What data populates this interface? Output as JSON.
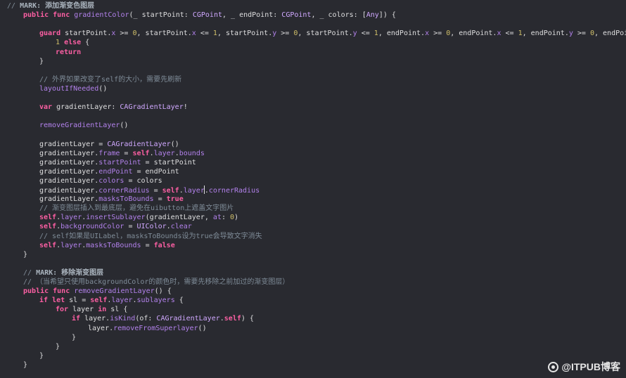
{
  "editor": {
    "lines": [
      {
        "indent": 0,
        "tokens": [
          {
            "t": "// ",
            "c": "c-comment"
          },
          {
            "t": "MARK: 添加渐变色图层",
            "c": "c-mark"
          }
        ]
      },
      {
        "indent": 1,
        "tokens": [
          {
            "t": "public func ",
            "c": "c-kw"
          },
          {
            "t": "gradientColor",
            "c": "c-call"
          },
          {
            "t": "(_ startPoint: ",
            "c": "c-plain"
          },
          {
            "t": "CGPoint",
            "c": "c-type"
          },
          {
            "t": ", _ endPoint: ",
            "c": "c-plain"
          },
          {
            "t": "CGPoint",
            "c": "c-type"
          },
          {
            "t": ", _ colors: [",
            "c": "c-plain"
          },
          {
            "t": "Any",
            "c": "c-type"
          },
          {
            "t": "]) {",
            "c": "c-plain"
          }
        ]
      },
      {
        "indent": 0,
        "tokens": []
      },
      {
        "indent": 2,
        "tokens": [
          {
            "t": "guard ",
            "c": "c-kw"
          },
          {
            "t": "startPoint.",
            "c": "c-plain"
          },
          {
            "t": "x",
            "c": "c-call"
          },
          {
            "t": " >= ",
            "c": "c-plain"
          },
          {
            "t": "0",
            "c": "c-num"
          },
          {
            "t": ", startPoint.",
            "c": "c-plain"
          },
          {
            "t": "x",
            "c": "c-call"
          },
          {
            "t": " <= ",
            "c": "c-plain"
          },
          {
            "t": "1",
            "c": "c-num"
          },
          {
            "t": ", startPoint.",
            "c": "c-plain"
          },
          {
            "t": "y",
            "c": "c-call"
          },
          {
            "t": " >= ",
            "c": "c-plain"
          },
          {
            "t": "0",
            "c": "c-num"
          },
          {
            "t": ", startPoint.",
            "c": "c-plain"
          },
          {
            "t": "y",
            "c": "c-call"
          },
          {
            "t": " <= ",
            "c": "c-plain"
          },
          {
            "t": "1",
            "c": "c-num"
          },
          {
            "t": ", endPoint.",
            "c": "c-plain"
          },
          {
            "t": "x",
            "c": "c-call"
          },
          {
            "t": " >= ",
            "c": "c-plain"
          },
          {
            "t": "0",
            "c": "c-num"
          },
          {
            "t": ", endPoint.",
            "c": "c-plain"
          },
          {
            "t": "x",
            "c": "c-call"
          },
          {
            "t": " <= ",
            "c": "c-plain"
          },
          {
            "t": "1",
            "c": "c-num"
          },
          {
            "t": ", endPoint.",
            "c": "c-plain"
          },
          {
            "t": "y",
            "c": "c-call"
          },
          {
            "t": " >= ",
            "c": "c-plain"
          },
          {
            "t": "0",
            "c": "c-num"
          },
          {
            "t": ", endPoint.",
            "c": "c-plain"
          },
          {
            "t": "y",
            "c": "c-call"
          },
          {
            "t": " <=",
            "c": "c-plain"
          }
        ]
      },
      {
        "indent": 3,
        "tokens": [
          {
            "t": "1",
            "c": "c-num"
          },
          {
            "t": " ",
            "c": "c-plain"
          },
          {
            "t": "else",
            "c": "c-kw"
          },
          {
            "t": " {",
            "c": "c-plain"
          }
        ]
      },
      {
        "indent": 3,
        "tokens": [
          {
            "t": "return",
            "c": "c-kw"
          }
        ]
      },
      {
        "indent": 2,
        "tokens": [
          {
            "t": "}",
            "c": "c-plain"
          }
        ]
      },
      {
        "indent": 0,
        "tokens": []
      },
      {
        "indent": 2,
        "tokens": [
          {
            "t": "// 外界如果改变了self的大小，需要先刷新",
            "c": "c-comment"
          }
        ]
      },
      {
        "indent": 2,
        "tokens": [
          {
            "t": "layoutIfNeeded",
            "c": "c-call"
          },
          {
            "t": "()",
            "c": "c-plain"
          }
        ]
      },
      {
        "indent": 0,
        "tokens": []
      },
      {
        "indent": 2,
        "tokens": [
          {
            "t": "var ",
            "c": "c-kw"
          },
          {
            "t": "gradientLayer: ",
            "c": "c-plain"
          },
          {
            "t": "CAGradientLayer",
            "c": "c-type"
          },
          {
            "t": "!",
            "c": "c-plain"
          }
        ]
      },
      {
        "indent": 0,
        "tokens": []
      },
      {
        "indent": 2,
        "tokens": [
          {
            "t": "removeGradientLayer",
            "c": "c-call"
          },
          {
            "t": "()",
            "c": "c-plain"
          }
        ]
      },
      {
        "indent": 0,
        "tokens": []
      },
      {
        "indent": 2,
        "tokens": [
          {
            "t": "gradientLayer = ",
            "c": "c-plain"
          },
          {
            "t": "CAGradientLayer",
            "c": "c-type"
          },
          {
            "t": "()",
            "c": "c-plain"
          }
        ]
      },
      {
        "indent": 2,
        "tokens": [
          {
            "t": "gradientLayer.",
            "c": "c-plain"
          },
          {
            "t": "frame",
            "c": "c-call"
          },
          {
            "t": " = ",
            "c": "c-plain"
          },
          {
            "t": "self",
            "c": "c-kw"
          },
          {
            "t": ".",
            "c": "c-plain"
          },
          {
            "t": "layer",
            "c": "c-call"
          },
          {
            "t": ".",
            "c": "c-plain"
          },
          {
            "t": "bounds",
            "c": "c-call"
          }
        ]
      },
      {
        "indent": 2,
        "tokens": [
          {
            "t": "gradientLayer.",
            "c": "c-plain"
          },
          {
            "t": "startPoint",
            "c": "c-call"
          },
          {
            "t": " = startPoint",
            "c": "c-plain"
          }
        ]
      },
      {
        "indent": 2,
        "tokens": [
          {
            "t": "gradientLayer.",
            "c": "c-plain"
          },
          {
            "t": "endPoint",
            "c": "c-call"
          },
          {
            "t": " = endPoint",
            "c": "c-plain"
          }
        ]
      },
      {
        "indent": 2,
        "tokens": [
          {
            "t": "gradientLayer.",
            "c": "c-plain"
          },
          {
            "t": "colors",
            "c": "c-call"
          },
          {
            "t": " = colors",
            "c": "c-plain"
          }
        ]
      },
      {
        "indent": 2,
        "tokens": [
          {
            "t": "gradientLayer.",
            "c": "c-plain"
          },
          {
            "t": "cornerRadius",
            "c": "c-call"
          },
          {
            "t": " = ",
            "c": "c-plain"
          },
          {
            "t": "self",
            "c": "c-kw"
          },
          {
            "t": ".",
            "c": "c-plain"
          },
          {
            "t": "layer",
            "c": "c-call"
          },
          {
            "t": "|",
            "c": "caret"
          },
          {
            "t": ".",
            "c": "c-plain"
          },
          {
            "t": "cornerRadius",
            "c": "c-call"
          }
        ]
      },
      {
        "indent": 2,
        "tokens": [
          {
            "t": "gradientLayer.",
            "c": "c-plain"
          },
          {
            "t": "masksToBounds",
            "c": "c-call"
          },
          {
            "t": " = ",
            "c": "c-plain"
          },
          {
            "t": "true",
            "c": "c-kw"
          }
        ]
      },
      {
        "indent": 2,
        "tokens": [
          {
            "t": "// 渐变图层插入到最底层，避免在uibutton上遮盖文字图片",
            "c": "c-comment"
          }
        ]
      },
      {
        "indent": 2,
        "tokens": [
          {
            "t": "self",
            "c": "c-kw"
          },
          {
            "t": ".",
            "c": "c-plain"
          },
          {
            "t": "layer",
            "c": "c-call"
          },
          {
            "t": ".",
            "c": "c-plain"
          },
          {
            "t": "insertSublayer",
            "c": "c-call"
          },
          {
            "t": "(gradientLayer, ",
            "c": "c-plain"
          },
          {
            "t": "at",
            "c": "c-call"
          },
          {
            "t": ": ",
            "c": "c-plain"
          },
          {
            "t": "0",
            "c": "c-num"
          },
          {
            "t": ")",
            "c": "c-plain"
          }
        ]
      },
      {
        "indent": 2,
        "tokens": [
          {
            "t": "self",
            "c": "c-kw"
          },
          {
            "t": ".",
            "c": "c-plain"
          },
          {
            "t": "backgroundColor",
            "c": "c-call"
          },
          {
            "t": " = ",
            "c": "c-plain"
          },
          {
            "t": "UIColor",
            "c": "c-type"
          },
          {
            "t": ".",
            "c": "c-plain"
          },
          {
            "t": "clear",
            "c": "c-call"
          }
        ]
      },
      {
        "indent": 2,
        "tokens": [
          {
            "t": "// self如果是UILabel，masksToBounds设为true会导致文字消失",
            "c": "c-comment"
          }
        ]
      },
      {
        "indent": 2,
        "tokens": [
          {
            "t": "self",
            "c": "c-kw"
          },
          {
            "t": ".",
            "c": "c-plain"
          },
          {
            "t": "layer",
            "c": "c-call"
          },
          {
            "t": ".",
            "c": "c-plain"
          },
          {
            "t": "masksToBounds",
            "c": "c-call"
          },
          {
            "t": " = ",
            "c": "c-plain"
          },
          {
            "t": "false",
            "c": "c-kw"
          }
        ]
      },
      {
        "indent": 1,
        "tokens": [
          {
            "t": "}",
            "c": "c-plain"
          }
        ]
      },
      {
        "indent": 0,
        "tokens": []
      },
      {
        "indent": 1,
        "tokens": [
          {
            "t": "// ",
            "c": "c-comment"
          },
          {
            "t": "MARK: 移除渐变图层",
            "c": "c-mark"
          }
        ]
      },
      {
        "indent": 1,
        "tokens": [
          {
            "t": "// （当希望只使用backgroundColor的颜色时，需要先移除之前加过的渐变图层）",
            "c": "c-comment"
          }
        ]
      },
      {
        "indent": 1,
        "tokens": [
          {
            "t": "public func ",
            "c": "c-kw"
          },
          {
            "t": "removeGradientLayer",
            "c": "c-call"
          },
          {
            "t": "() {",
            "c": "c-plain"
          }
        ]
      },
      {
        "indent": 2,
        "tokens": [
          {
            "t": "if let ",
            "c": "c-kw"
          },
          {
            "t": "sl = ",
            "c": "c-plain"
          },
          {
            "t": "self",
            "c": "c-kw"
          },
          {
            "t": ".",
            "c": "c-plain"
          },
          {
            "t": "layer",
            "c": "c-call"
          },
          {
            "t": ".",
            "c": "c-plain"
          },
          {
            "t": "sublayers",
            "c": "c-call"
          },
          {
            "t": " {",
            "c": "c-plain"
          }
        ]
      },
      {
        "indent": 3,
        "tokens": [
          {
            "t": "for ",
            "c": "c-kw"
          },
          {
            "t": "layer ",
            "c": "c-plain"
          },
          {
            "t": "in ",
            "c": "c-kw"
          },
          {
            "t": "sl {",
            "c": "c-plain"
          }
        ]
      },
      {
        "indent": 4,
        "tokens": [
          {
            "t": "if ",
            "c": "c-kw"
          },
          {
            "t": "layer.",
            "c": "c-plain"
          },
          {
            "t": "isKind",
            "c": "c-call"
          },
          {
            "t": "(of: ",
            "c": "c-plain"
          },
          {
            "t": "CAGradientLayer",
            "c": "c-type"
          },
          {
            "t": ".",
            "c": "c-plain"
          },
          {
            "t": "self",
            "c": "c-kw"
          },
          {
            "t": ") {",
            "c": "c-plain"
          }
        ]
      },
      {
        "indent": 5,
        "tokens": [
          {
            "t": "layer.",
            "c": "c-plain"
          },
          {
            "t": "removeFromSuperlayer",
            "c": "c-call"
          },
          {
            "t": "()",
            "c": "c-plain"
          }
        ]
      },
      {
        "indent": 4,
        "tokens": [
          {
            "t": "}",
            "c": "c-plain"
          }
        ]
      },
      {
        "indent": 3,
        "tokens": [
          {
            "t": "}",
            "c": "c-plain"
          }
        ]
      },
      {
        "indent": 2,
        "tokens": [
          {
            "t": "}",
            "c": "c-plain"
          }
        ]
      },
      {
        "indent": 1,
        "tokens": [
          {
            "t": "}",
            "c": "c-plain"
          }
        ]
      }
    ]
  },
  "watermark": {
    "icon": "itpub-logo-icon",
    "text": "@ITPUB博客"
  }
}
